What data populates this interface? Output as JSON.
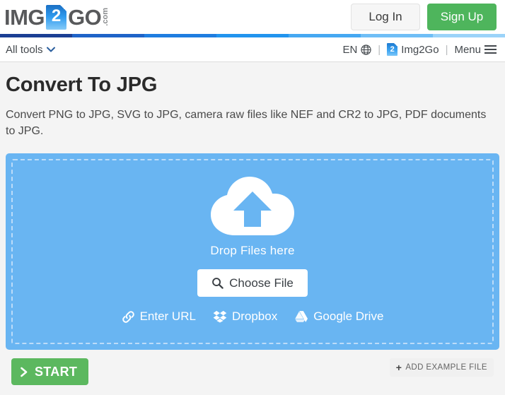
{
  "header": {
    "logo": {
      "part1": "IMG",
      "doc_number": "2",
      "part2": "GO",
      "tld": ".com"
    },
    "login_label": "Log In",
    "signup_label": "Sign Up",
    "signup_color": "#4eb55c"
  },
  "stripe": {
    "colors": [
      "#1b3f94",
      "#1f63c8",
      "#1f7de0",
      "#2194ee",
      "#45a8f2",
      "#6fbef6",
      "#9bd3f9"
    ]
  },
  "navbar": {
    "all_tools_label": "All tools",
    "language_label": "EN",
    "separator": "|",
    "site_label": "Img2Go",
    "site_badge": "2",
    "menu_label": "Menu"
  },
  "main": {
    "title": "Convert To JPG",
    "description": "Convert PNG to JPG, SVG to JPG, camera raw files like NEF and CR2 to JPG, PDF documents to JPG."
  },
  "dropzone": {
    "background_color": "#69b5f2",
    "border_color": "#bcdcf9",
    "drop_label": "Drop Files here",
    "choose_file_label": "Choose File",
    "sources": [
      {
        "label": "Enter URL",
        "icon": "link-icon"
      },
      {
        "label": "Dropbox",
        "icon": "dropbox-icon"
      },
      {
        "label": "Google Drive",
        "icon": "google-drive-icon"
      }
    ]
  },
  "actions": {
    "start_label": "START",
    "start_color": "#5cb85f",
    "add_example_label": "ADD EXAMPLE FILE",
    "add_example_plus": "+"
  }
}
